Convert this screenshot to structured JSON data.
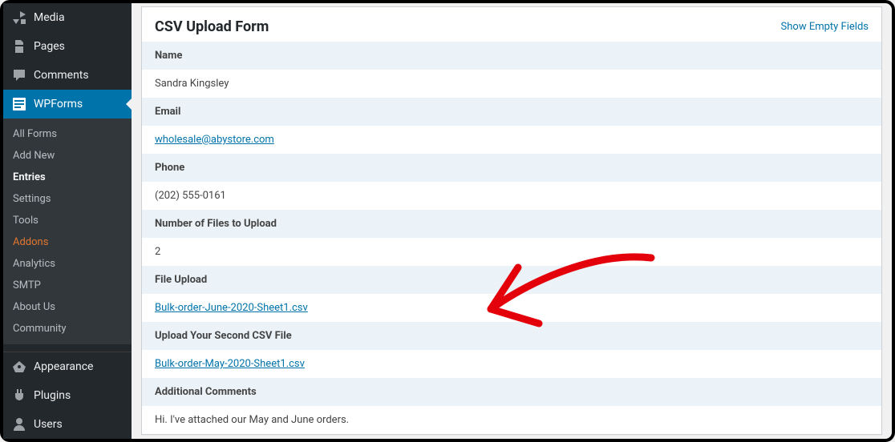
{
  "sidebar": {
    "top": [
      {
        "label": "Media",
        "icon": "media"
      },
      {
        "label": "Pages",
        "icon": "pages"
      },
      {
        "label": "Comments",
        "icon": "comments"
      }
    ],
    "active": {
      "label": "WPForms",
      "icon": "wpforms"
    },
    "submenu": [
      {
        "label": "All Forms"
      },
      {
        "label": "Add New"
      },
      {
        "label": "Entries",
        "current": true
      },
      {
        "label": "Settings"
      },
      {
        "label": "Tools"
      },
      {
        "label": "Addons",
        "addons": true
      },
      {
        "label": "Analytics"
      },
      {
        "label": "SMTP"
      },
      {
        "label": "About Us"
      },
      {
        "label": "Community"
      }
    ],
    "bottom": [
      {
        "label": "Appearance",
        "icon": "appearance"
      },
      {
        "label": "Plugins",
        "icon": "plugins"
      },
      {
        "label": "Users",
        "icon": "users"
      }
    ]
  },
  "panel": {
    "title": "CSV Upload Form",
    "action": "Show Empty Fields",
    "fields": [
      {
        "label": "Name",
        "value": "Sandra Kingsley",
        "link": false
      },
      {
        "label": "Email",
        "value": "wholesale@abystore.com",
        "link": true
      },
      {
        "label": "Phone",
        "value": "(202) 555-0161",
        "link": false
      },
      {
        "label": "Number of Files to Upload",
        "value": "2",
        "link": false
      },
      {
        "label": "File Upload",
        "value": "Bulk-order-June-2020-Sheet1.csv",
        "link": true
      },
      {
        "label": "Upload Your Second CSV File",
        "value": "Bulk-order-May-2020-Sheet1.csv",
        "link": true
      },
      {
        "label": "Additional Comments",
        "value": "Hi. I've attached our May and June orders.",
        "link": false
      }
    ]
  }
}
